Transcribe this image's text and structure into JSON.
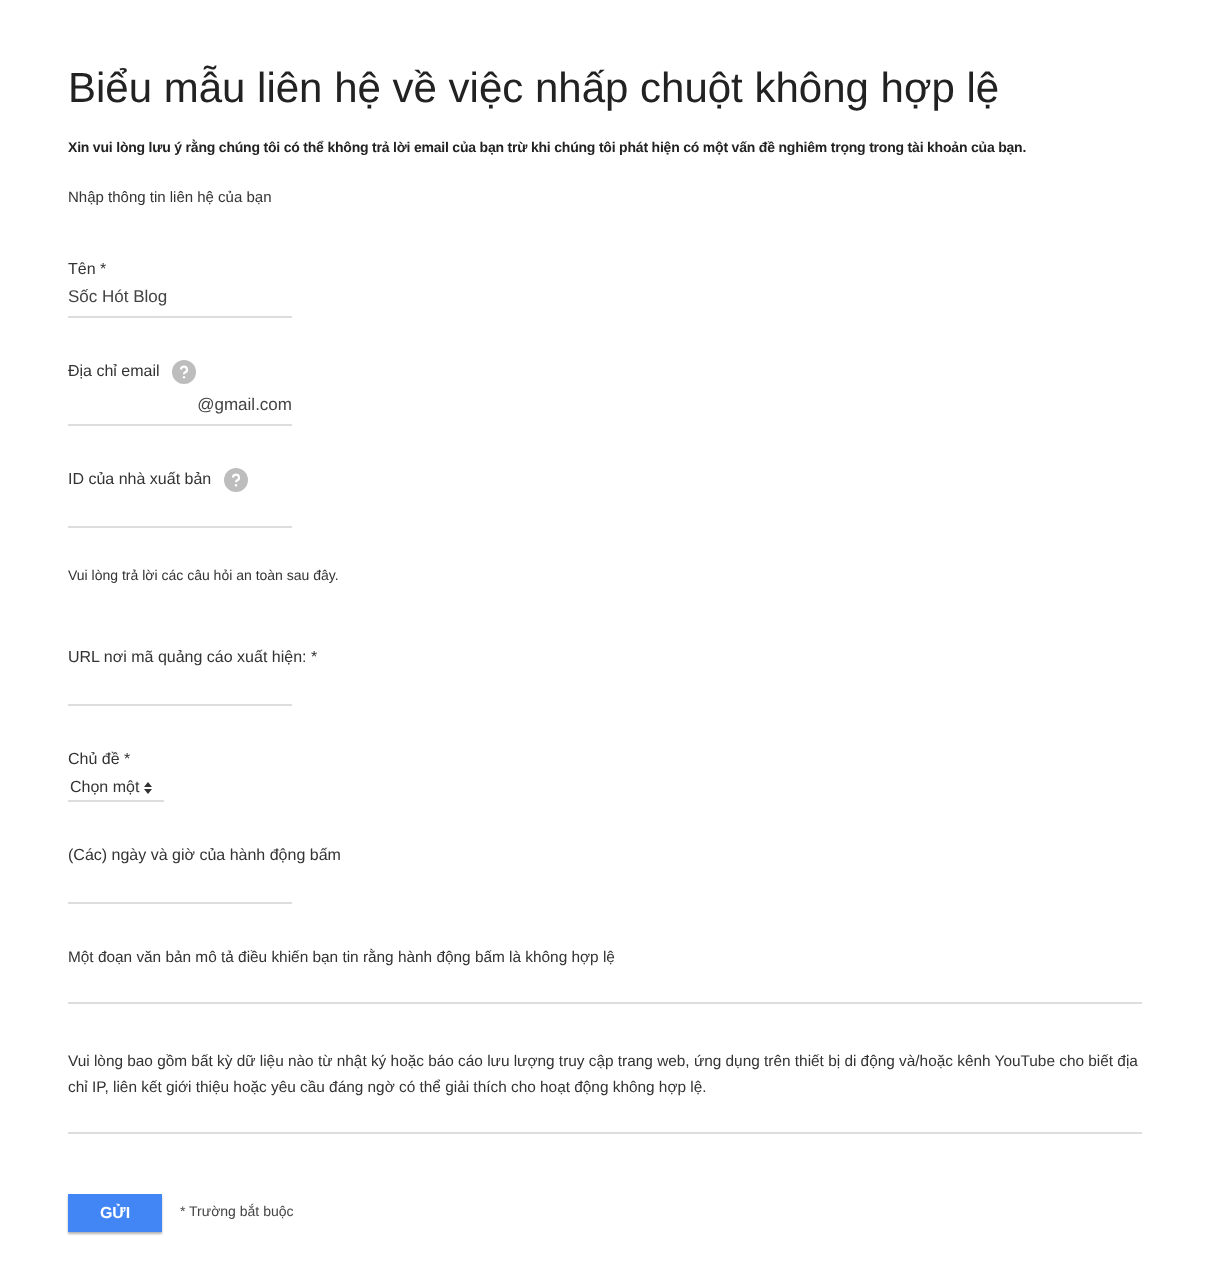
{
  "title": "Biểu mẫu liên hệ về việc nhấp chuột không hợp lệ",
  "notice": "Xin vui lòng lưu ý rằng chúng tôi có thể không trả lời email của bạn trừ khi chúng tôi phát hiện có một vấn đề nghiêm trọng trong tài khoản của bạn.",
  "subtitle": "Nhập thông tin liên hệ của bạn",
  "fields": [
    {
      "kind": "text",
      "label": "Tên *",
      "value": "Sốc Hót Blog",
      "help": false
    },
    {
      "kind": "suffix",
      "label": "Địa chỉ email",
      "suffix": "@gmail.com",
      "help": true
    },
    {
      "kind": "text",
      "label": "ID của nhà xuất bản",
      "help": true
    },
    {
      "kind": "note",
      "label": "Vui lòng trả lời các câu hỏi an toàn sau đây."
    },
    {
      "kind": "text",
      "label": "URL nơi mã quảng cáo xuất hiện: *",
      "help": false
    },
    {
      "kind": "select",
      "label": "Chủ đề *",
      "value": "Chọn một",
      "help": false
    },
    {
      "kind": "text",
      "label": "(Các) ngày và giờ của hành động bấm",
      "help": false
    },
    {
      "kind": "textarea",
      "label": "Một đoạn văn bản mô tả điều khiến bạn tin rằng hành động bấm là không hợp lệ"
    },
    {
      "kind": "textarea",
      "label": "Vui lòng bao gồm bất kỳ dữ liệu nào từ nhật ký hoặc báo cáo lưu lượng truy cập trang web, ứng dụng trên thiết bị di động và/hoặc kênh YouTube cho biết địa chỉ IP, liên kết giới thiệu hoặc yêu cầu đáng ngờ có thể giải thích cho hoạt động không hợp lệ."
    }
  ],
  "submit": "GỬI",
  "required_note": "* Trường bắt buộc"
}
